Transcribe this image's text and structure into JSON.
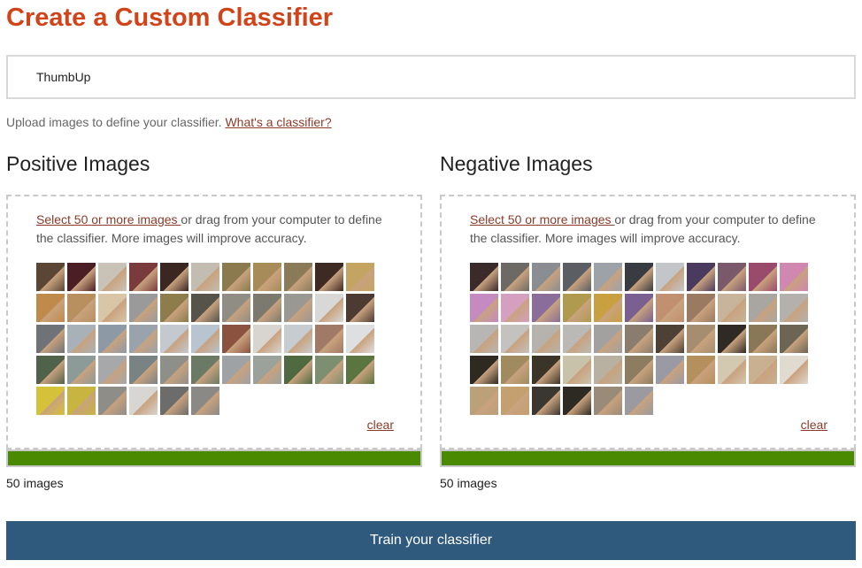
{
  "page": {
    "title": "Create a Custom Classifier"
  },
  "classifier_name": {
    "value": "ThumbUp",
    "placeholder": "ThumbUp"
  },
  "upload_info": {
    "text": "Upload images to define your classifier. ",
    "link_text": "What's a classifier?"
  },
  "positive": {
    "title": "Positive Images",
    "select_link": "Select 50 or more images ",
    "instruction_rest": "or drag from your computer to define the classifier. More images will improve accuracy.",
    "clear_label": "clear",
    "count_text": "50 images",
    "progress": 1.0,
    "rows": [
      11,
      11,
      11,
      11,
      6
    ],
    "colors": [
      "#5b4636",
      "#4a1e24",
      "#c9c3b7",
      "#7a3b3d",
      "#3a2722",
      "#c2bdb0",
      "#8a7a4e",
      "#a78b58",
      "#8a7a58",
      "#3d2a22",
      "#c4a462",
      "#c08a4b",
      "#b89060",
      "#d8c6a7",
      "#9a9a9a",
      "#8d7c4c",
      "#55534a",
      "#8f8d84",
      "#7c7a6f",
      "#999892",
      "#d8d8d6",
      "#4d3b33",
      "#6f7276",
      "#a9b1b8",
      "#8d9aa6",
      "#9aa3ab",
      "#c3c9cf",
      "#b8c4cf",
      "#8c5240",
      "#d8d5d1",
      "#c7ccd0",
      "#a07a66",
      "#dedfe0",
      "#51624a",
      "#8c9a98",
      "#a7a8aa",
      "#7a8384",
      "#8e8f89",
      "#6b7a64",
      "#9ea2a4",
      "#9ba29c",
      "#4f6a40",
      "#7c8f70",
      "#5a7540",
      "#d6c13a",
      "#c8b440",
      "#8f8d88",
      "#d7d6d2",
      "#6c6c6a",
      "#8a8985"
    ]
  },
  "negative": {
    "title": "Negative Images",
    "select_link": "Select 50 or more images ",
    "instruction_rest": "or drag from your computer to define the classifier. More images will improve accuracy.",
    "clear_label": "clear",
    "count_text": "50 images",
    "progress": 1.0,
    "rows": [
      11,
      11,
      11,
      11,
      6
    ],
    "colors": [
      "#3b2a2a",
      "#6d6a65",
      "#8a8e92",
      "#5b5f64",
      "#9ca2a8",
      "#383c40",
      "#c3c6c9",
      "#4a3a5d",
      "#7a5a6a",
      "#9a4a6a",
      "#d087b0",
      "#c58ac0",
      "#d5a0c0",
      "#8a6d9a",
      "#b09a50",
      "#c8a040",
      "#7a6090",
      "#c09070",
      "#9a7a60",
      "#c8b49a",
      "#a9a6a2",
      "#b4b1ad",
      "#b8b6b2",
      "#c4c2be",
      "#b6b3ae",
      "#bbb9b5",
      "#a3a1a0",
      "#8a7d6d",
      "#4d4035",
      "#a68d6f",
      "#2f2a24",
      "#8a7757",
      "#6d6554",
      "#2e2a22",
      "#a08a60",
      "#3b3428",
      "#c9c2ab",
      "#b8b0a0",
      "#8c7c60",
      "#9a9aa4",
      "#b5905f",
      "#d3c8b0",
      "#c8b090",
      "#e0dad0",
      "#bba07a",
      "#c4a070",
      "#3a3630",
      "#2d2a24",
      "#9a8a78",
      "#9a9aa0"
    ]
  },
  "train_button": {
    "label": "Train your classifier"
  }
}
